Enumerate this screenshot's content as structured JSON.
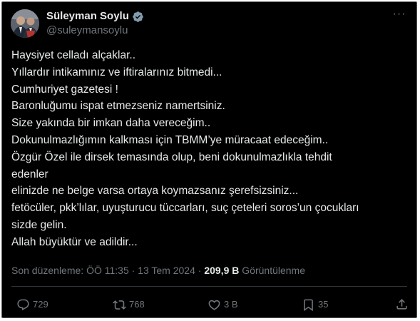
{
  "author": {
    "display_name": "Süleyman Soylu",
    "handle": "@suleymansoylu"
  },
  "more_label": "···",
  "tweet_lines": [
    "Haysiyet celladı alçaklar..",
    "Yıllardır intikamınız ve iftiralarınız bitmedi...",
    "Cumhuriyet gazetesi !",
    "Baronluğumu ispat etmezseniz namertsiniz.",
    "Size yakında bir imkan daha vereceğim..",
    "Dokunulmazlığımın kalkması için TBMM’ye müracaat edeceğim..",
    "Özgür Özel ile dirsek temasında olup, beni dokunulmazlıkla tehdit",
    "edenler",
    "elinizde ne belge varsa ortaya koymazsanız şerefsizsiniz...",
    "fetöcüler, pkk’lılar, uyuşturucu tüccarları, suç çeteleri soros’un çocukları",
    "sizde gelin.",
    "Allah büyüktür ve adildir..."
  ],
  "meta": {
    "edited_label": "Son düzenleme: ÖÖ 11:35",
    "separator": "·",
    "date": "13 Tem 2024",
    "views_count": "209,9 B",
    "views_label": "Görüntülenme"
  },
  "actions": {
    "replies": "729",
    "reposts": "768",
    "likes": "3 B",
    "bookmarks": "35"
  },
  "colors": {
    "background": "#000000",
    "primary_text": "#e7e9ea",
    "secondary_text": "#71767b",
    "verified_badge": "#829aab"
  }
}
